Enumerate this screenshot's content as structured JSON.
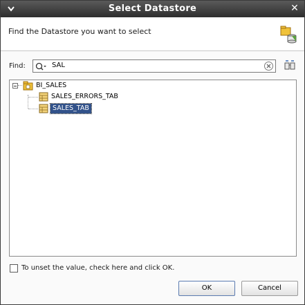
{
  "window": {
    "title": "Select Datastore"
  },
  "header": {
    "description": "Find the Datastore you want to select"
  },
  "find": {
    "label": "Find:",
    "value": "SAL"
  },
  "tree": {
    "root": {
      "label": "BI_SALES",
      "expanded": true
    },
    "children": [
      {
        "label": "SALES_ERRORS_TAB",
        "selected": false
      },
      {
        "label": "SALES_TAB",
        "selected": true
      }
    ]
  },
  "unset": {
    "label": "To unset the value, check here and click OK.",
    "checked": false
  },
  "buttons": {
    "ok": "OK",
    "cancel": "Cancel"
  },
  "colors": {
    "selection": "#32528a",
    "title_bar": "#3a3a3a",
    "folder": "#e8b23a",
    "datastore": "#d9a63a"
  }
}
